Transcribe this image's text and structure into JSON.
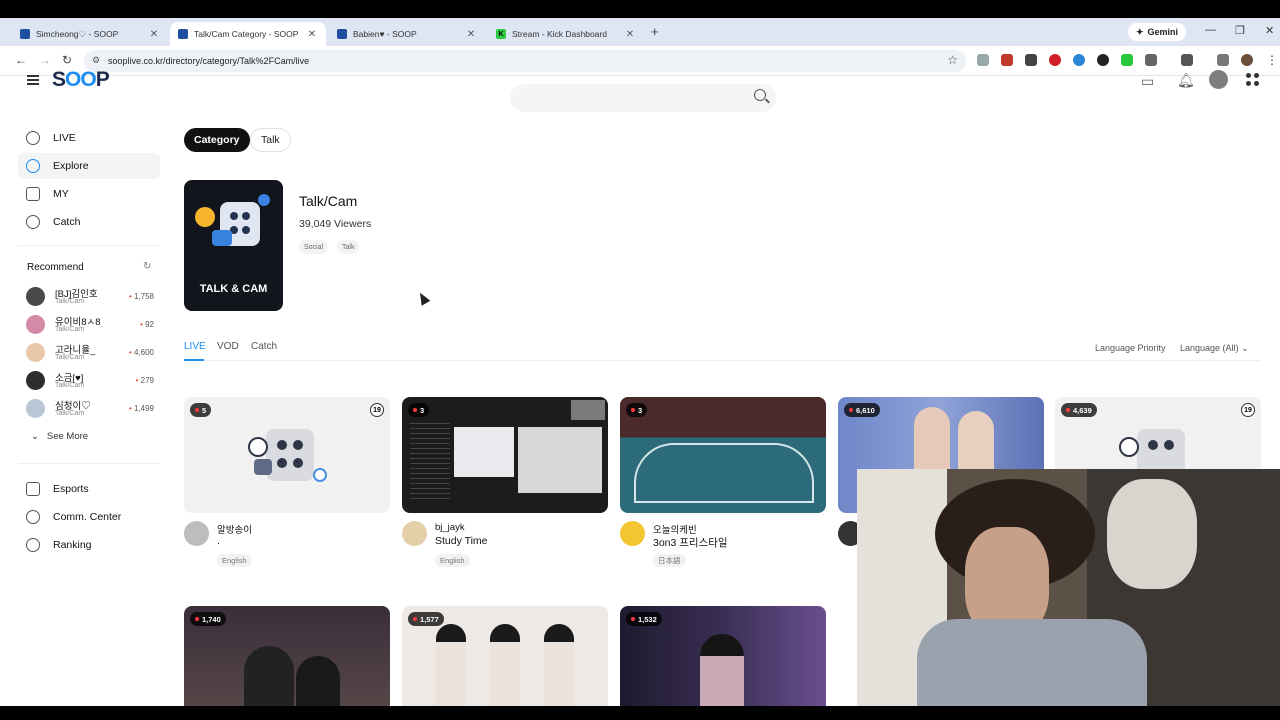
{
  "browser": {
    "tabs": [
      {
        "title": "Simcheong♡ - SOOP",
        "active": false
      },
      {
        "title": "Talk/Cam Category - SOOP",
        "active": true
      },
      {
        "title": "Babien♥ - SOOP",
        "active": false
      },
      {
        "title": "Stream - Kick Dashboard",
        "active": false
      }
    ],
    "gemini_label": "Gemini",
    "url": "sooplive.co.kr/directory/category/Talk%2FCam/live"
  },
  "site": {
    "logo_prefix": "S",
    "logo_oo": "OO",
    "logo_suffix": "P"
  },
  "sidebar": {
    "nav": [
      {
        "label": "LIVE",
        "icon": "live-icon"
      },
      {
        "label": "Explore",
        "icon": "explore-icon",
        "selected": true
      },
      {
        "label": "MY",
        "icon": "star-icon"
      },
      {
        "label": "Catch",
        "icon": "catch-icon"
      }
    ],
    "recommend_title": "Recommend",
    "recommend": [
      {
        "name": "[BJ]김인호",
        "category": "Talk/Cam",
        "viewers": "1,758"
      },
      {
        "name": "유이비8ㅅ8",
        "category": "Talk/Cam",
        "viewers": "92"
      },
      {
        "name": "고라니율_",
        "category": "Talk/Cam",
        "viewers": "4,600"
      },
      {
        "name": "소금[♥]",
        "category": "Talk/Cam",
        "viewers": "279"
      },
      {
        "name": "심청이♡",
        "category": "Talk/Cam",
        "viewers": "1,499"
      }
    ],
    "see_more": "See More",
    "more_nav": [
      {
        "label": "Esports",
        "icon": "trophy-icon"
      },
      {
        "label": "Comm. Center",
        "icon": "community-icon"
      },
      {
        "label": "Ranking",
        "icon": "ranking-icon"
      }
    ]
  },
  "main": {
    "pills": [
      "Category",
      "Talk"
    ],
    "category": {
      "thumb_text": "TALK & CAM",
      "title": "Talk/Cam",
      "viewers": "39,049 Viewers",
      "tags": [
        "Social",
        "Talk"
      ]
    },
    "subtabs": [
      "LIVE",
      "VOD",
      "Catch"
    ],
    "language_priority": "Language Priority",
    "language_select": "Language (All)",
    "cards": [
      {
        "viewers": "5",
        "age": "19",
        "name": "알방송이",
        "title": ".",
        "lang": "English"
      },
      {
        "viewers": "3",
        "name": "bj_jayk",
        "title": "Study Time",
        "lang": "English"
      },
      {
        "viewers": "3",
        "name": "오늘의케빈",
        "title": "3on3 프리스타일",
        "lang": "日本語"
      },
      {
        "viewers": "6,610"
      },
      {
        "viewers": "4,639",
        "age": "19"
      },
      {
        "viewers": "1,740"
      },
      {
        "viewers": "1,577"
      },
      {
        "viewers": "1,532"
      }
    ]
  },
  "colors": {
    "accent": "#1f8cf0",
    "live_dot": "#ff3b3b",
    "logo_dark": "#1d2b4f"
  }
}
